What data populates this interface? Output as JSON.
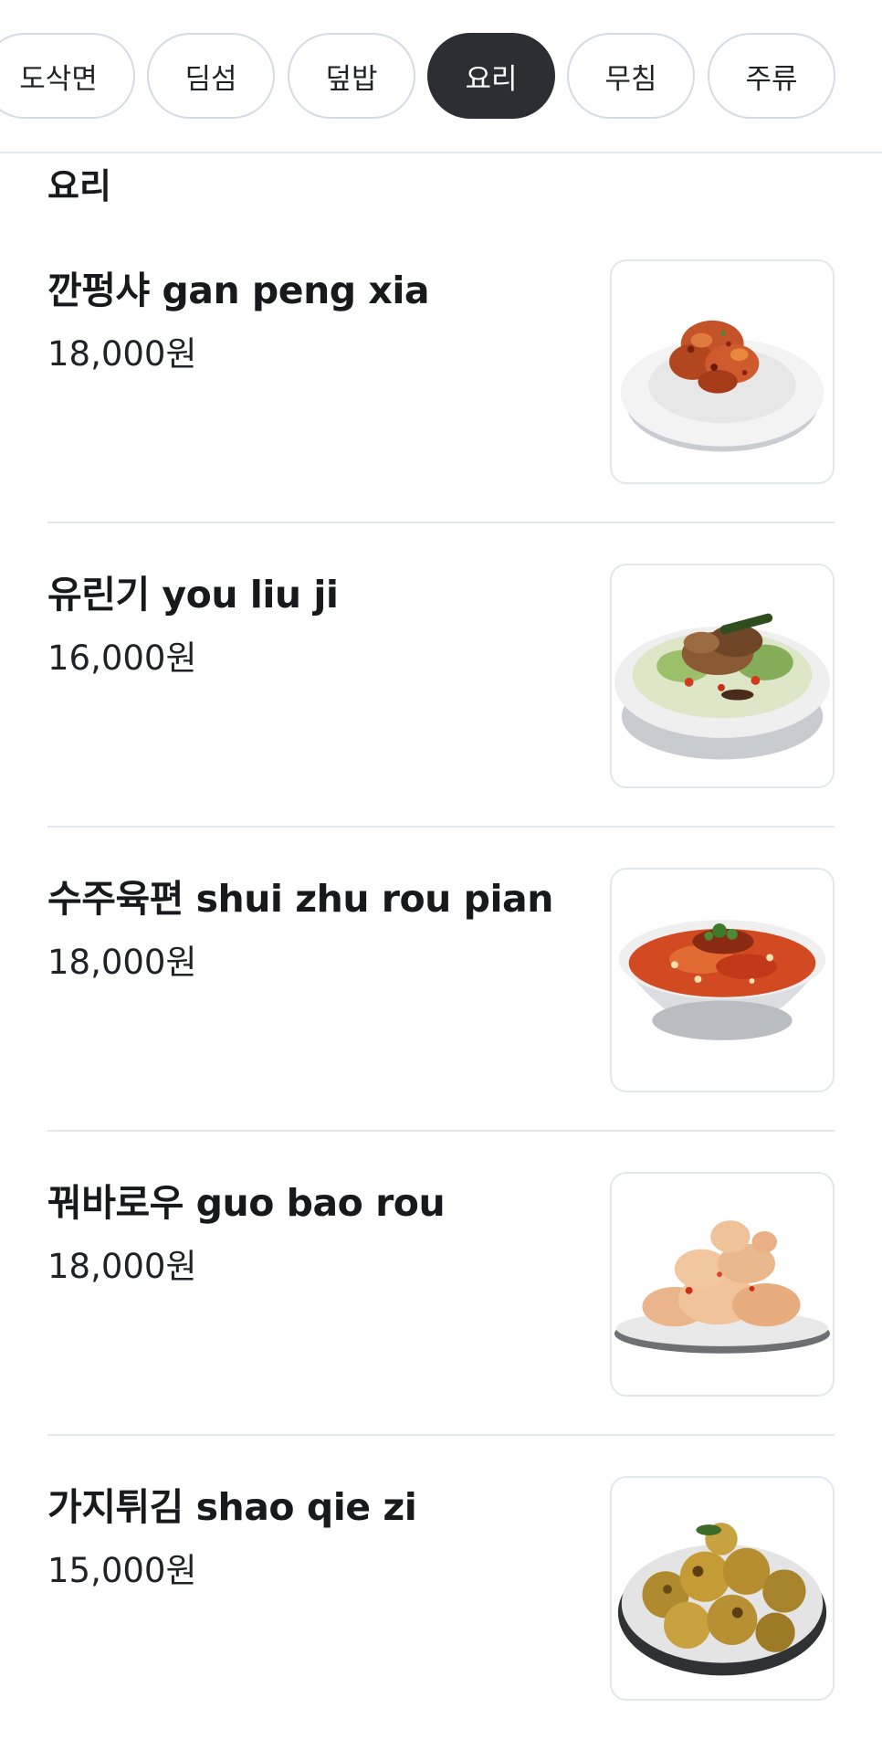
{
  "categories": [
    {
      "label": "도삭면",
      "active": false
    },
    {
      "label": "딤섬",
      "active": false
    },
    {
      "label": "덮밥",
      "active": false
    },
    {
      "label": "요리",
      "active": true
    },
    {
      "label": "무침",
      "active": false
    },
    {
      "label": "주류",
      "active": false
    }
  ],
  "section": {
    "title": "요리"
  },
  "items": [
    {
      "name": "깐펑샤 gan peng xia",
      "price": "18,000원",
      "image": "fried-shrimp-dish-photo"
    },
    {
      "name": "유린기 you liu ji",
      "price": "16,000원",
      "image": "fried-chicken-salad-photo"
    },
    {
      "name": "수주육편 shui zhu rou pian",
      "price": "18,000원",
      "image": "spicy-boiled-pork-photo"
    },
    {
      "name": "꿔바로우 guo bao rou",
      "price": "18,000원",
      "image": "sweet-sour-pork-photo"
    },
    {
      "name": "가지튀김 shao qie zi",
      "price": "15,000원",
      "image": "fried-eggplant-photo"
    }
  ]
}
